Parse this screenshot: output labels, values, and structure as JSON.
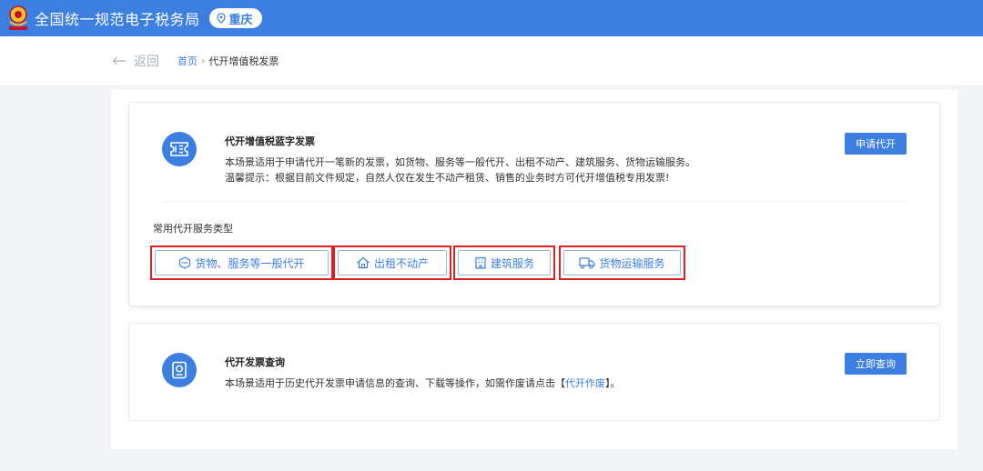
{
  "header": {
    "site_title": "全国统一规范电子税务局",
    "region": "重庆"
  },
  "nav": {
    "back_label": "返回",
    "breadcrumb_home": "首页",
    "breadcrumb_separator": "›",
    "breadcrumb_current": "代开增值税发票"
  },
  "card_invoice": {
    "title": "代开增值税蓝字发票",
    "desc_line1": "本场景适用于申请代开一笔新的发票，如货物、服务等一般代开、出租不动产、建筑服务、货物运输服务。",
    "desc_line2": "温馨提示：根据目前文件规定，自然人仅在发生不动产租赁、销售的业务时方可代开增值税专用发票!",
    "action_label": "申请代开",
    "section_label": "常用代开服务类型",
    "services": [
      {
        "label": "货物、服务等一般代开",
        "icon": "chat-bubble-icon"
      },
      {
        "label": "出租不动产",
        "icon": "house-icon"
      },
      {
        "label": "建筑服务",
        "icon": "building-icon"
      },
      {
        "label": "货物运输服务",
        "icon": "truck-icon"
      }
    ]
  },
  "card_query": {
    "title": "代开发票查询",
    "desc_prefix": "本场景适用于历史代开发票申请信息的查询、下载等操作，如需作废请点击【",
    "desc_link": "代开作废",
    "desc_suffix": "】。",
    "action_label": "立即查询"
  },
  "colors": {
    "brand_blue": "#3d7fe0",
    "highlight_red": "#e02020"
  }
}
